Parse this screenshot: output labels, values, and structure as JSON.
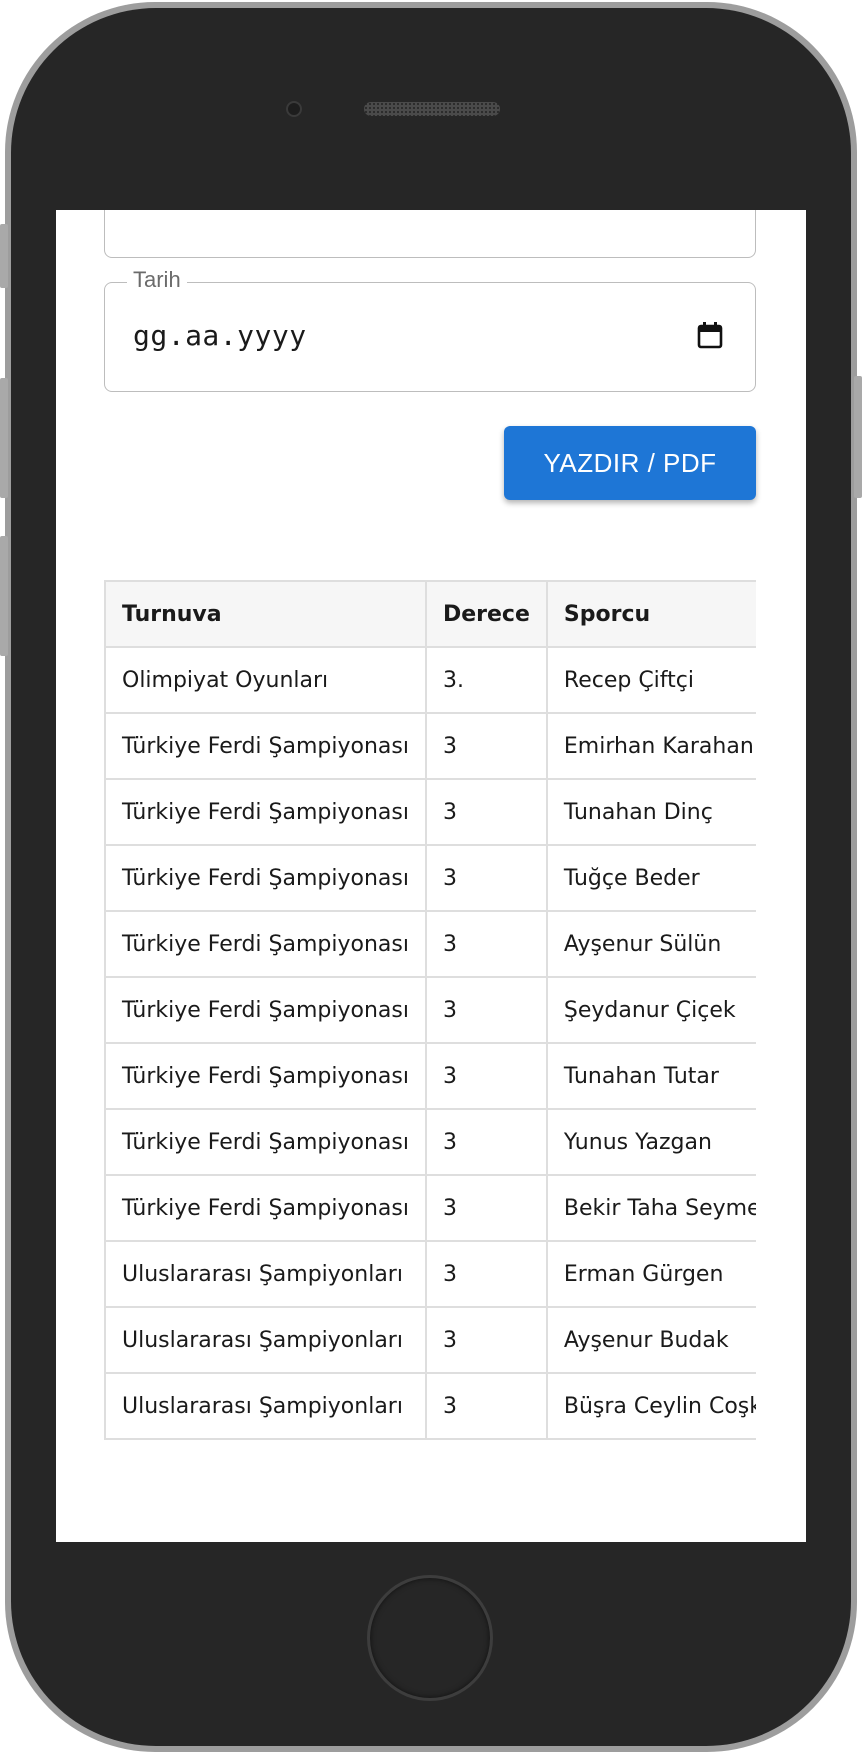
{
  "form": {
    "date_legend": "Tarih",
    "date_placeholder": "gg.aa.yyyy",
    "print_button": "YAZDIR / PDF"
  },
  "table": {
    "headers": [
      "Turnuva",
      "Derece",
      "Sporcu"
    ],
    "rows": [
      [
        "Olimpiyat Oyunları",
        "3.",
        "Recep Çiftçi"
      ],
      [
        "Türkiye Ferdi Şampiyonası",
        "3",
        "Emirhan Karahan"
      ],
      [
        "Türkiye Ferdi Şampiyonası",
        "3",
        "Tunahan Dinç"
      ],
      [
        "Türkiye Ferdi Şampiyonası",
        "3",
        "Tuğçe Beder"
      ],
      [
        "Türkiye Ferdi Şampiyonası",
        "3",
        "Ayşenur Sülün"
      ],
      [
        "Türkiye Ferdi Şampiyonası",
        "3",
        "Şeydanur Çiçek"
      ],
      [
        "Türkiye Ferdi Şampiyonası",
        "3",
        "Tunahan Tutar"
      ],
      [
        "Türkiye Ferdi Şampiyonası",
        "3",
        "Yunus Yazgan"
      ],
      [
        "Türkiye Ferdi Şampiyonası",
        "3",
        "Bekir Taha Seymen"
      ],
      [
        "Uluslararası Şampiyonları",
        "3",
        "Erman Gürgen"
      ],
      [
        "Uluslararası Şampiyonları",
        "3",
        "Ayşenur Budak"
      ],
      [
        "Uluslararası Şampiyonları",
        "3",
        "Büşra Ceylin Coşkun"
      ]
    ]
  },
  "colors": {
    "accent": "#1e76d6",
    "phone_body": "#262626"
  }
}
